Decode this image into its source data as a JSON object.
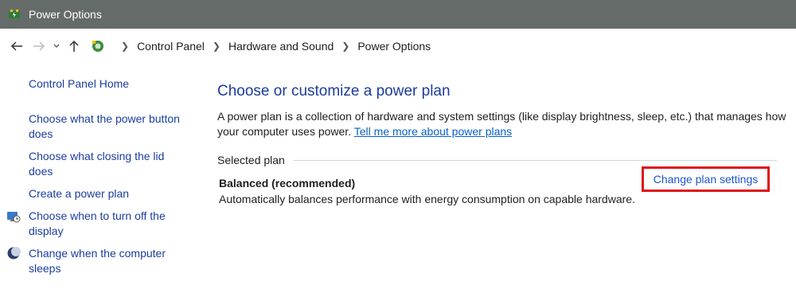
{
  "window": {
    "title": "Power Options"
  },
  "address": {
    "crumbs": [
      "Control Panel",
      "Hardware and Sound",
      "Power Options"
    ]
  },
  "sidebar": {
    "home": "Control Panel Home",
    "links": [
      "Choose what the power button does",
      "Choose what closing the lid does",
      "Create a power plan",
      "Choose when to turn off the display",
      "Change when the computer sleeps"
    ]
  },
  "main": {
    "title": "Choose or customize a power plan",
    "description": "A power plan is a collection of hardware and system settings (like display brightness, sleep, etc.) that manages how your computer uses power.",
    "tell_more_link": "Tell me more about power plans",
    "section_label": "Selected plan",
    "plan_name": "Balanced (recommended)",
    "plan_description": "Automatically balances performance with energy consumption on capable hardware.",
    "change_link": "Change plan settings"
  },
  "colors": {
    "titlebar": "#656b68",
    "link": "#1a3d9e",
    "heading": "#1c3b9c",
    "highlight_border": "#e0111b"
  }
}
